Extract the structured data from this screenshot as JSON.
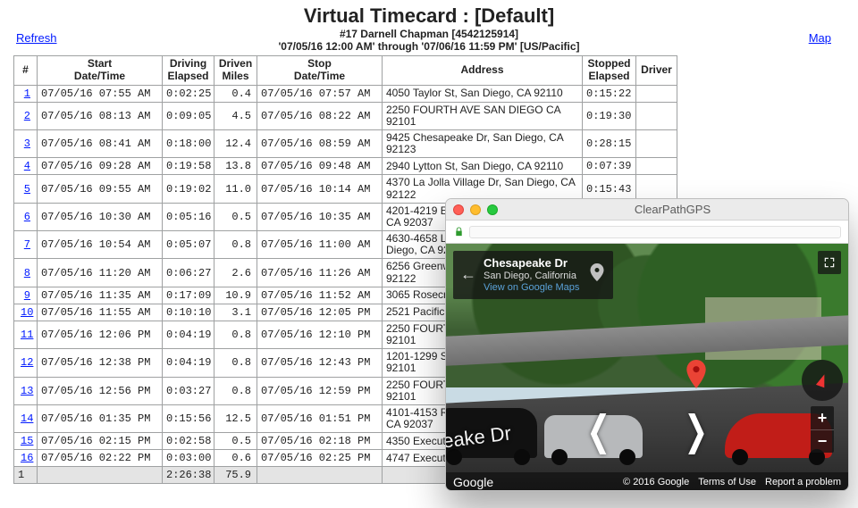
{
  "title": "Virtual Timecard : [Default]",
  "sub1": "#17 Darnell Chapman [4542125914]",
  "sub2": "'07/05/16 12:00 AM' through '07/06/16 11:59 PM' [US/Pacific]",
  "refresh_label": "Refresh",
  "map_label": "Map",
  "columns": {
    "num": "#",
    "start": "Start\nDate/Time",
    "de": "Driving\nElapsed",
    "dm": "Driven\nMiles",
    "stop": "Stop\nDate/Time",
    "addr": "Address",
    "se": "Stopped\nElapsed",
    "driver": "Driver"
  },
  "rows": [
    {
      "n": "1",
      "start": "07/05/16 07:55 AM",
      "de": "0:02:25",
      "dm": "0.4",
      "stop": "07/05/16 07:57 AM",
      "addr": "4050 Taylor St, San Diego, CA 92110",
      "se": "0:15:22",
      "drv": ""
    },
    {
      "n": "2",
      "start": "07/05/16 08:13 AM",
      "de": "0:09:05",
      "dm": "4.5",
      "stop": "07/05/16 08:22 AM",
      "addr": "2250 FOURTH AVE SAN DIEGO CA 92101",
      "se": "0:19:30",
      "drv": ""
    },
    {
      "n": "3",
      "start": "07/05/16 08:41 AM",
      "de": "0:18:00",
      "dm": "12.4",
      "stop": "07/05/16 08:59 AM",
      "addr": "9425 Chesapeake Dr, San Diego, CA 92123",
      "se": "0:28:15",
      "drv": ""
    },
    {
      "n": "4",
      "start": "07/05/16 09:28 AM",
      "de": "0:19:58",
      "dm": "13.8",
      "stop": "07/05/16 09:48 AM",
      "addr": "2940 Lytton St, San Diego, CA 92110",
      "se": "0:07:39",
      "drv": ""
    },
    {
      "n": "5",
      "start": "07/05/16 09:55 AM",
      "de": "0:19:02",
      "dm": "11.0",
      "stop": "07/05/16 10:14 AM",
      "addr": "4370 La Jolla Village Dr, San Diego, CA 92122",
      "se": "0:15:43",
      "drv": ""
    },
    {
      "n": "6",
      "start": "07/05/16 10:30 AM",
      "de": "0:05:16",
      "dm": "0.5",
      "stop": "07/05/16 10:35 AM",
      "addr": "4201-4219 Executive Square, La Jolla, CA 92037",
      "se": "",
      "drv": ""
    },
    {
      "n": "7",
      "start": "07/05/16 10:54 AM",
      "de": "0:05:07",
      "dm": "0.8",
      "stop": "07/05/16 11:00 AM",
      "addr": "4630-4658 La Jolla Village Dr, San Diego, CA 92121",
      "se": "",
      "drv": ""
    },
    {
      "n": "8",
      "start": "07/05/16 11:20 AM",
      "de": "0:06:27",
      "dm": "2.6",
      "stop": "07/05/16 11:26 AM",
      "addr": "6256 Greenwich Dr, San Diego, CA 92122",
      "se": "",
      "drv": ""
    },
    {
      "n": "9",
      "start": "07/05/16 11:35 AM",
      "de": "0:17:09",
      "dm": "10.9",
      "stop": "07/05/16 11:52 AM",
      "addr": "3065 Rosecrans Pl, San Diego, CA",
      "se": "",
      "drv": ""
    },
    {
      "n": "10",
      "start": "07/05/16 11:55 AM",
      "de": "0:10:10",
      "dm": "3.1",
      "stop": "07/05/16 12:05 PM",
      "addr": "2521 Pacific Hwy, San Diego, CA",
      "se": "",
      "drv": ""
    },
    {
      "n": "11",
      "start": "07/05/16 12:06 PM",
      "de": "0:04:19",
      "dm": "0.8",
      "stop": "07/05/16 12:10 PM",
      "addr": "2250 FOURTH AVE SAN DIEGO CA 92101",
      "se": "",
      "drv": ""
    },
    {
      "n": "12",
      "start": "07/05/16 12:38 PM",
      "de": "0:04:19",
      "dm": "0.8",
      "stop": "07/05/16 12:43 PM",
      "addr": "1201-1299 Sixth Ave, San Diego, CA 92101",
      "se": "",
      "drv": ""
    },
    {
      "n": "13",
      "start": "07/05/16 12:56 PM",
      "de": "0:03:27",
      "dm": "0.8",
      "stop": "07/05/16 12:59 PM",
      "addr": "2250 FOURTH AVE SAN DIEGO CA 92101",
      "se": "",
      "drv": ""
    },
    {
      "n": "14",
      "start": "07/05/16 01:35 PM",
      "de": "0:15:56",
      "dm": "12.5",
      "stop": "07/05/16 01:51 PM",
      "addr": "4101-4153 Regents Park Row, La Jolla, CA 92037",
      "se": "",
      "drv": ""
    },
    {
      "n": "15",
      "start": "07/05/16 02:15 PM",
      "de": "0:02:58",
      "dm": "0.5",
      "stop": "07/05/16 02:18 PM",
      "addr": "4350 Executive Dr, San Diego, CA",
      "se": "",
      "drv": ""
    },
    {
      "n": "16",
      "start": "07/05/16 02:22 PM",
      "de": "0:03:00",
      "dm": "0.6",
      "stop": "07/05/16 02:25 PM",
      "addr": "4747 Executive Dr, San Diego, CA",
      "se": "",
      "drv": ""
    }
  ],
  "totals": {
    "count": "1",
    "de": "2:26:38",
    "dm": "75.9"
  },
  "popup": {
    "title": "ClearPathGPS",
    "place_title": "Chesapeake Dr",
    "place_sub": "San Diego, California",
    "view_link": "View on Google Maps",
    "street_label": "eake Dr",
    "google": "Google",
    "copyright": "© 2016 Google",
    "terms": "Terms of Use",
    "report": "Report a problem",
    "compass_overlay": "C     p"
  }
}
